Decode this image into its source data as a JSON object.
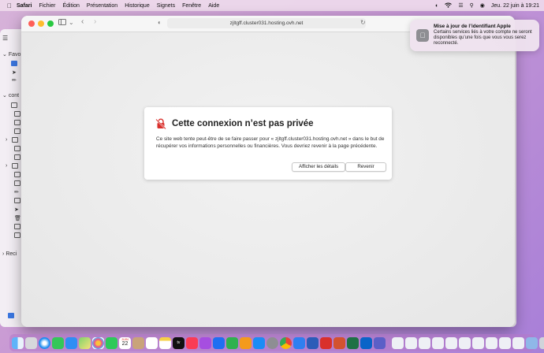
{
  "menubar": {
    "app": "Safari",
    "items": [
      "Fichier",
      "Édition",
      "Présentation",
      "Historique",
      "Signets",
      "Fenêtre",
      "Aide"
    ],
    "datetime": "Jeu. 22 juin à  19:21"
  },
  "mail_sidebar": {
    "favorites_label": "Favo",
    "account_label": "cont",
    "recent_label": "Reci"
  },
  "safari": {
    "url": "zjltgff.cluster031.hosting.ovh.net"
  },
  "error": {
    "title": "Cette connexion n’est pas privée",
    "message": "Ce site web tente peut-être de se faire passer pour « zjltgff.cluster031.hosting.ovh.net » dans le but de récupérer vos informations personnelles ou financières. Vous devriez revenir à la page précédente.",
    "details_button": "Afficher les détails",
    "back_button": "Revenir"
  },
  "notification": {
    "title": "Mise à jour de l’identifiant Apple",
    "body": "Certains services liés à votre compte ne seront disponibles qu’une fois que vous vous serez reconnecté."
  },
  "dock": {
    "calendar_day": "22",
    "calendar_month": "JUIN",
    "tv_label": "tv"
  },
  "colors": {
    "lock_red": "#d9302c",
    "accent": "#3b76e0"
  }
}
